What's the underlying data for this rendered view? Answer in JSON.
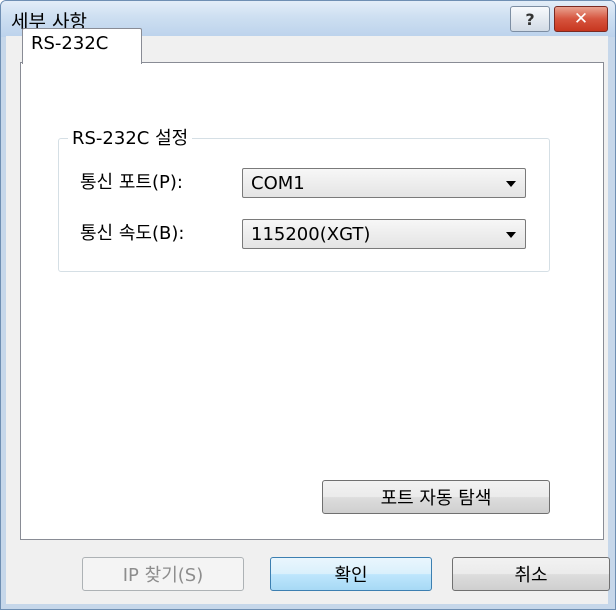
{
  "window": {
    "title": "세부 사항"
  },
  "tabs": [
    {
      "label": "RS-232C",
      "selected": true
    }
  ],
  "group": {
    "title": "RS-232C 설정",
    "port_label": "통신 포트(P):",
    "port_value": "COM1",
    "speed_label": "통신 속도(B):",
    "speed_value": "115200(XGT)"
  },
  "buttons": {
    "auto_detect": "포트 자동 탐색",
    "find_ip": "IP 찾기(S)",
    "ok": "확인",
    "cancel": "취소"
  },
  "icons": {
    "help": "?",
    "close": "✕"
  }
}
